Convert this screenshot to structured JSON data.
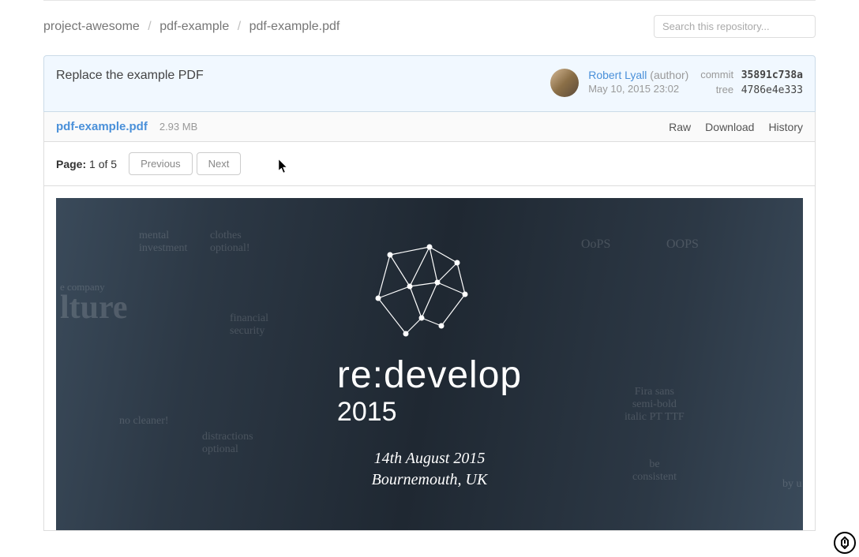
{
  "breadcrumb": {
    "parts": [
      "project-awesome",
      "pdf-example",
      "pdf-example.pdf"
    ]
  },
  "search": {
    "placeholder": "Search this repository..."
  },
  "commit": {
    "message": "Replace the example PDF",
    "author_name": "Robert Lyall",
    "author_role": "(author)",
    "date": "May 10, 2015 23:02",
    "commit_label": "commit",
    "commit_hash": "35891c738a",
    "tree_label": "tree",
    "tree_hash": "4786e4e333"
  },
  "file": {
    "name": "pdf-example.pdf",
    "size": "2.93 MB",
    "actions": {
      "raw": "Raw",
      "download": "Download",
      "history": "History"
    }
  },
  "pager": {
    "label": "Page:",
    "current": "1",
    "of_word": "of",
    "total": "5",
    "previous": "Previous",
    "next": "Next"
  },
  "pdf_content": {
    "title": "re:develop",
    "year": "2015",
    "date": "14th August 2015",
    "location": "Bournemouth, UK",
    "doodles": {
      "mental": "mental\ninvestment",
      "clothes": "clothes\noptional!",
      "culture": "lture",
      "company": "e company",
      "financial": "financial\nsecurity",
      "nocleaner": "no cleaner!",
      "distractions": "distractions\noptional",
      "oops1": "OoPS",
      "oops2": "OOPS",
      "fira": "Fira sans\nsemi-bold\nitalic PT TTF",
      "be_consistent": "be\nconsistent",
      "by": "by u"
    }
  }
}
